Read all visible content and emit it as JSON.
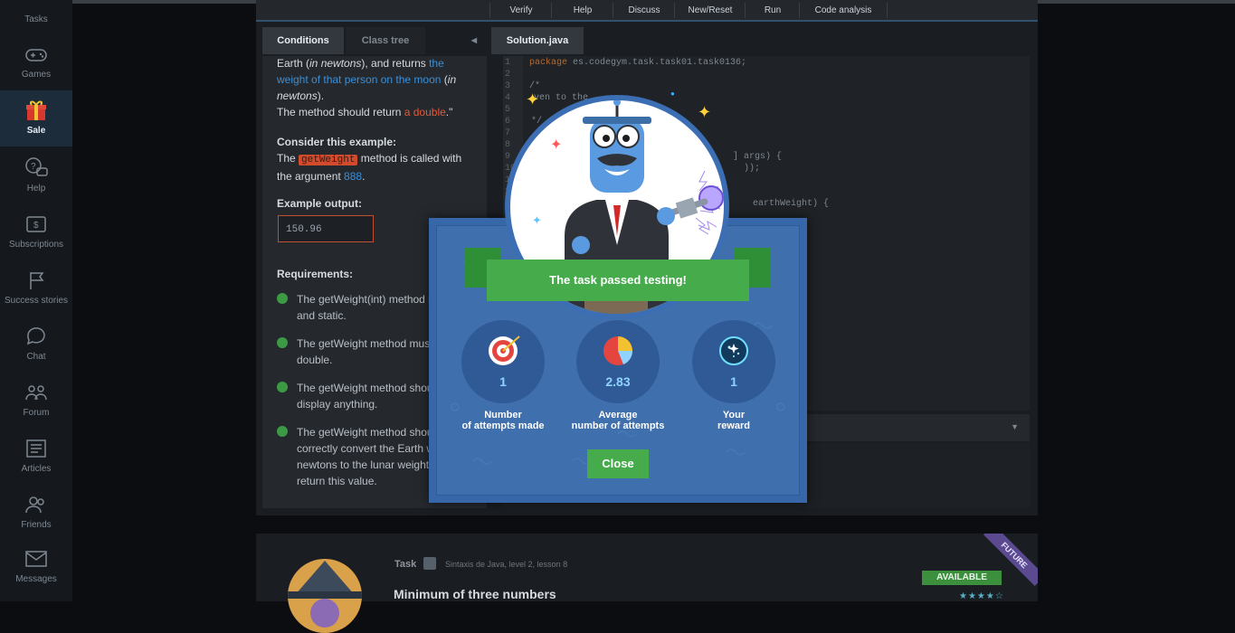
{
  "sidebar": {
    "items": [
      {
        "label": "Tasks",
        "icon": "tasks-icon"
      },
      {
        "label": "Games",
        "icon": "gamepad-icon"
      },
      {
        "label": "Sale",
        "icon": "gift-icon"
      },
      {
        "label": "Help",
        "icon": "help-bubble-icon"
      },
      {
        "label": "Subscriptions",
        "icon": "subscription-icon"
      },
      {
        "label": "Success stories",
        "icon": "flag-icon"
      },
      {
        "label": "Chat",
        "icon": "chat-icon"
      },
      {
        "label": "Forum",
        "icon": "forum-icon"
      },
      {
        "label": "Articles",
        "icon": "articles-icon"
      },
      {
        "label": "Friends",
        "icon": "friends-icon"
      },
      {
        "label": "Messages",
        "icon": "envelope-icon"
      }
    ]
  },
  "toolbar": {
    "verify": "Verify",
    "help": "Help",
    "discuss": "Discuss",
    "new_reset": "New/Reset",
    "run": "Run",
    "code_analysis": "Code analysis"
  },
  "tabs": {
    "conditions": "Conditions",
    "class_tree": "Class tree",
    "solution": "Solution.java"
  },
  "task": {
    "p1_a": "Earth (",
    "p1_b": "in newtons",
    "p1_c": "), and returns ",
    "p1_d": "the weight of that person on the moon",
    "p1_e": " (",
    "p1_f": "in newtons",
    "p1_g": ").",
    "p2_a": "The method should return ",
    "p2_b": "a double",
    "p2_c": ".\"",
    "example_heading": "Consider this example:",
    "ex_a": "The ",
    "ex_code": "getWeight",
    "ex_b": " method is called with the argument ",
    "ex_num": "888",
    "ex_c": ".",
    "output_heading": "Example output:",
    "output_value": "150.96",
    "requirements_heading": "Requirements:",
    "requirements": [
      "The getWeight(int) method public and static.",
      "The getWeight method mus double.",
      "The getWeight method shou display anything.",
      "The getWeight method shou correctly convert the Earth w newtons to the lunar weight then return this value."
    ]
  },
  "code": {
    "line_numbers": [
      "1",
      "2",
      "3",
      "4",
      "5",
      "6",
      "7",
      "8",
      "9",
      "10",
      "11",
      "12",
      "13",
      "14"
    ],
    "line1_kw": "package",
    "line1_rest": " es.codegym.task.task01.task0136;",
    "frag_comment_open": "/*",
    "frag_en": "ven to the",
    "frag_comment_close": "*/",
    "frag_args": "] args) {",
    "frag_paren": "));",
    "frag_earth": "earthWeight) {"
  },
  "modal": {
    "title": "The task passed testing!",
    "stats": [
      {
        "icon": "target-icon",
        "value": "1",
        "label_line1": "Number",
        "label_line2": "of attempts made"
      },
      {
        "icon": "pie-chart-icon",
        "value": "2.83",
        "label_line1": "Average",
        "label_line2": "number of attempts"
      },
      {
        "icon": "dark-matter-icon",
        "value": "1",
        "label_line1": "Your",
        "label_line2": "reward"
      }
    ],
    "close_label": "Close"
  },
  "card": {
    "task_label": "Task",
    "meta": "Sintaxis de Java,  level 2,  lesson 8",
    "title": "Minimum of three numbers",
    "status": "AVAILABLE",
    "ribbon": "FUTURE",
    "rating": "★★★★☆"
  },
  "colors": {
    "accent_blue": "#3767a8",
    "success_green": "#45ab4b",
    "sidebar_bg": "#15191e"
  }
}
